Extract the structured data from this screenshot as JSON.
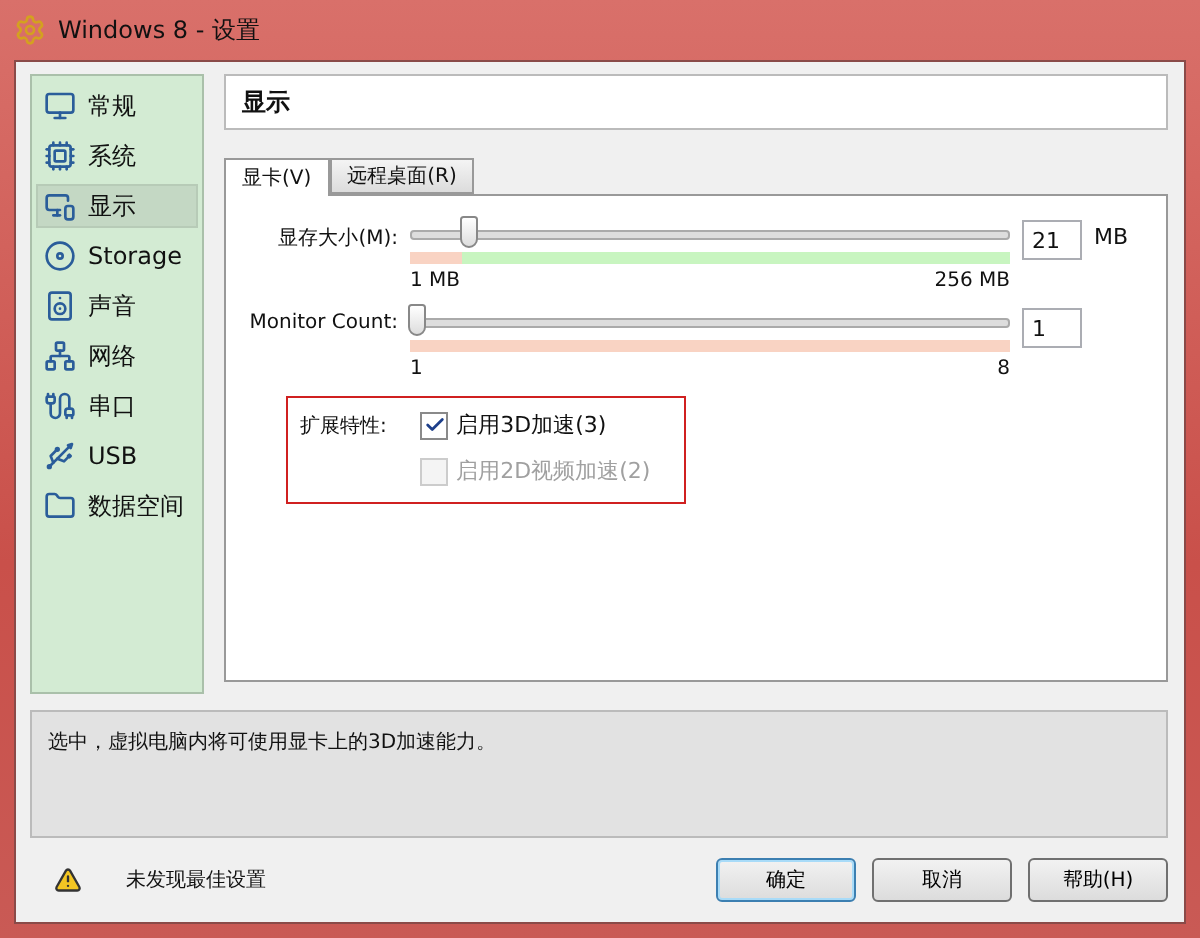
{
  "window": {
    "title": "Windows 8 - 设置"
  },
  "sidebar": {
    "items": [
      {
        "label": "常规",
        "selected": false
      },
      {
        "label": "系统",
        "selected": false
      },
      {
        "label": "显示",
        "selected": true
      },
      {
        "label": "Storage",
        "selected": false
      },
      {
        "label": "声音",
        "selected": false
      },
      {
        "label": "网络",
        "selected": false
      },
      {
        "label": "串口",
        "selected": false
      },
      {
        "label": "USB",
        "selected": false
      },
      {
        "label": "数据空间",
        "selected": false
      }
    ]
  },
  "page_title": "显示",
  "tabs": [
    {
      "label": "显卡(V)",
      "selected": true
    },
    {
      "label": "远程桌面(R)",
      "selected": false
    }
  ],
  "sliders": [
    {
      "label": "显存大小(M):",
      "level": 0.087,
      "value": "21",
      "unit": "MB",
      "min": "1 MB",
      "max": "256 MB",
      "color": "#c8f5c0"
    },
    {
      "label": "Monitor Count:",
      "level": 0,
      "value": "1",
      "min": "1",
      "max": "8",
      "color": "#f9d3c3"
    }
  ],
  "features": {
    "label": "扩展特性:",
    "options": [
      {
        "label": "启用3D加速(3)",
        "checked": true,
        "disabled": false
      },
      {
        "label": "启用2D视频加速(2)",
        "checked": false,
        "disabled": true
      }
    ]
  },
  "description": "选中，虚拟电脑内将可使用显卡上的3D加速能力。",
  "warning": "未发现最佳设置",
  "buttons": [
    {
      "label": "确定",
      "selected": true
    },
    {
      "label": "取消",
      "selected": false
    },
    {
      "label": "帮助(H)",
      "selected": false
    }
  ]
}
